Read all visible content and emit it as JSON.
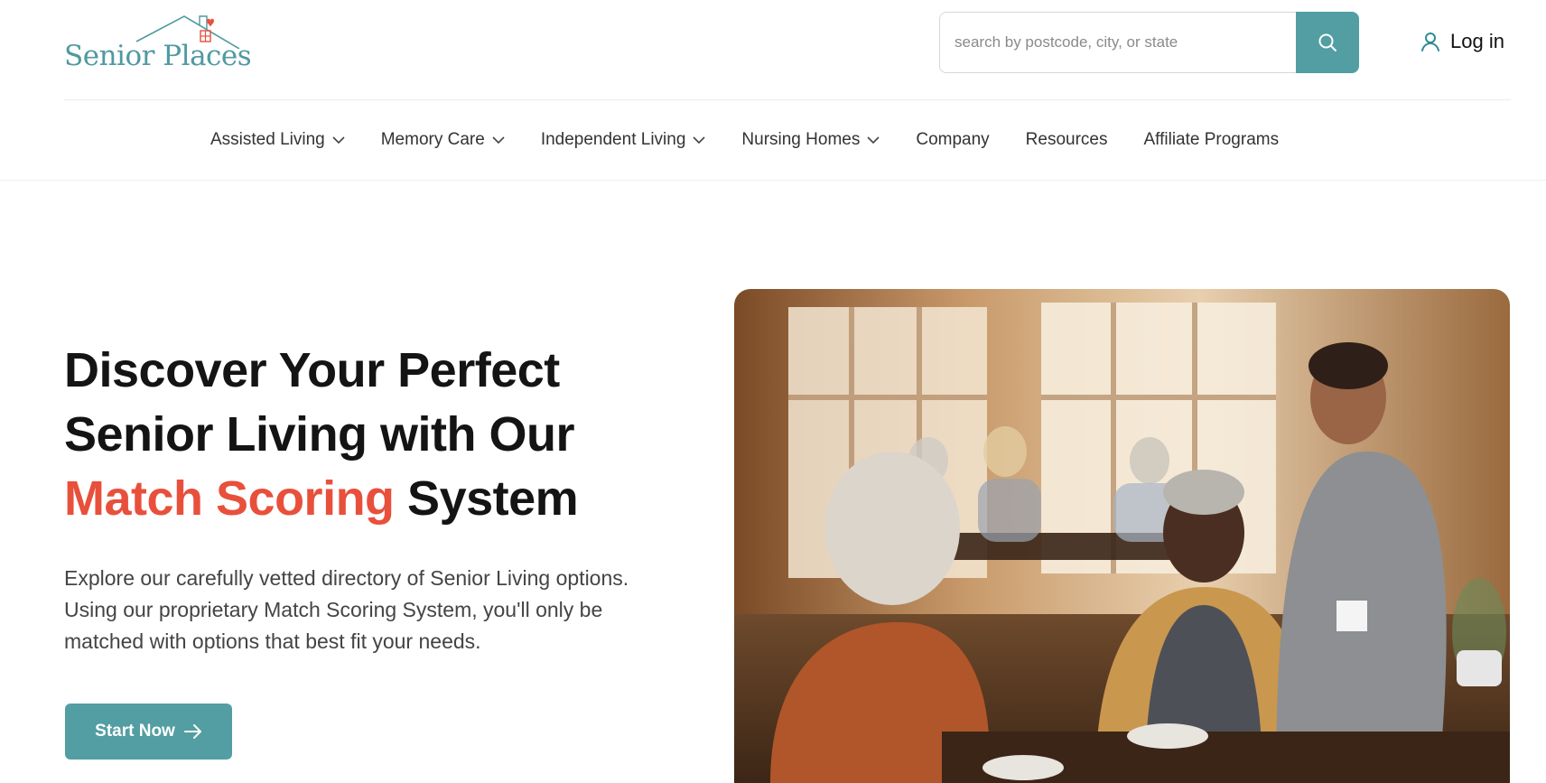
{
  "brand": {
    "name": "Senior Places",
    "color": "#4f9aa0",
    "heart_color": "#e8503c"
  },
  "search": {
    "placeholder": "search by postcode, city, or state",
    "button_icon": "search-icon",
    "button_color": "#529ea3"
  },
  "account": {
    "login_label": "Log in",
    "icon": "user-icon"
  },
  "nav": {
    "items": [
      {
        "label": "Assisted Living",
        "has_dropdown": true
      },
      {
        "label": "Memory Care",
        "has_dropdown": true
      },
      {
        "label": "Independent Living",
        "has_dropdown": true
      },
      {
        "label": "Nursing Homes",
        "has_dropdown": true
      },
      {
        "label": "Company",
        "has_dropdown": false
      },
      {
        "label": "Resources",
        "has_dropdown": false
      },
      {
        "label": "Affiliate Programs",
        "has_dropdown": false
      }
    ]
  },
  "hero": {
    "title_line1": "Discover Your Perfect",
    "title_line2": "Senior Living with Our",
    "title_highlight": "Match Scoring",
    "title_tail": " System",
    "highlight_color": "#e8503c",
    "description": "Explore our carefully vetted directory of Senior Living options. Using our proprietary Match Scoring System, you'll only be matched with options that best fit your needs.",
    "cta_label": "Start Now",
    "cta_icon": "arrow-right-icon"
  }
}
